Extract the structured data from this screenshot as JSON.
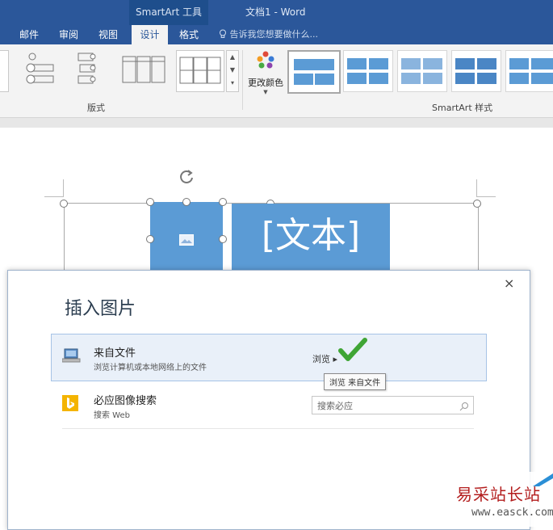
{
  "title_bar": {
    "context_label": "SmartArt 工具",
    "doc_title": "文档1 - Word"
  },
  "ribbon_tabs": [
    {
      "label": "邮件"
    },
    {
      "label": "审阅"
    },
    {
      "label": "视图"
    },
    {
      "label": "设计",
      "active": true
    },
    {
      "label": "格式"
    }
  ],
  "tell_me": "告诉我您想要做什么...",
  "ribbon": {
    "layouts_group_label": "版式",
    "change_colors_label": "更改颜色",
    "smartart_styles_label": "SmartArt 样式"
  },
  "canvas": {
    "text_placeholder": "[文本]"
  },
  "dialog": {
    "title": "插入图片",
    "close_glyph": "×",
    "rows": [
      {
        "title": "来自文件",
        "desc": "浏览计算机或本地网络上的文件",
        "action": "浏览 ▸"
      },
      {
        "title": "必应图像搜索",
        "desc": "搜索 Web",
        "search_placeholder": "搜索必应"
      }
    ],
    "tooltip": "浏览 来自文件"
  },
  "watermark": {
    "text": "易采站长站",
    "url": "www.easck.com"
  },
  "colors": {
    "ribbon_blue": "#2b579a",
    "smartart_blue": "#5b9bd5",
    "check_green": "#3fa535",
    "bing_yellow": "#f4b400"
  }
}
